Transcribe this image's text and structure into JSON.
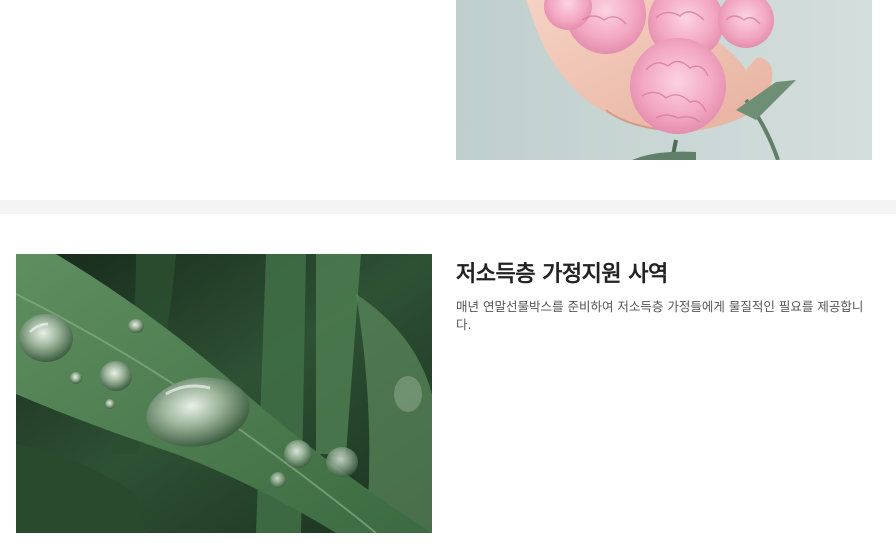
{
  "sections": [
    {
      "id": "carnation",
      "image": {
        "icon": "carnation-photo",
        "colors": {
          "sky": "#c9d6d4",
          "petal": "#f2a9c4",
          "hand": "#f1c7b8"
        }
      }
    },
    {
      "id": "low-income-support",
      "title": "저소득층 가정지원 사역",
      "description": "매년 연말선물박스를 준비하여 저소득층 가정들에게 물질적인 필요를 제공합니다.",
      "image": {
        "icon": "leaves-waterdrop-photo",
        "colors": {
          "leaf": "#3f6d44",
          "dark": "#1c3321"
        }
      }
    }
  ],
  "theme": {
    "band": "#f4f4f4",
    "title": "#222222",
    "text": "#555555"
  }
}
